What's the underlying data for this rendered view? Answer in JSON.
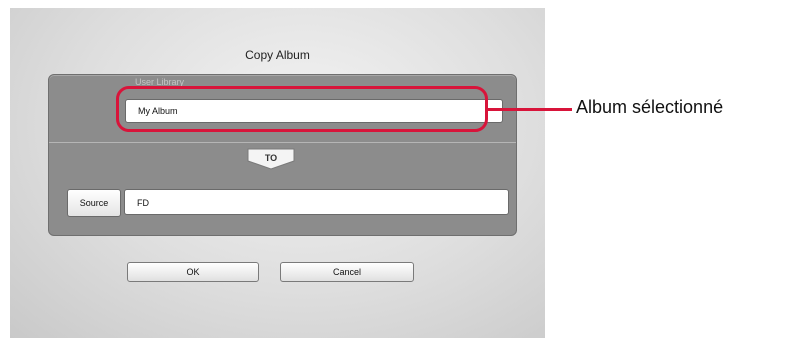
{
  "dialog": {
    "title": "Copy Album",
    "source_section_label": "User Library",
    "album_value": "My Album",
    "to_label": "TO",
    "source_button_label": "Source",
    "destination_value": "FD",
    "ok_label": "OK",
    "cancel_label": "Cancel"
  },
  "annotation": {
    "text": "Album sélectionné",
    "color": "#d8143a"
  }
}
